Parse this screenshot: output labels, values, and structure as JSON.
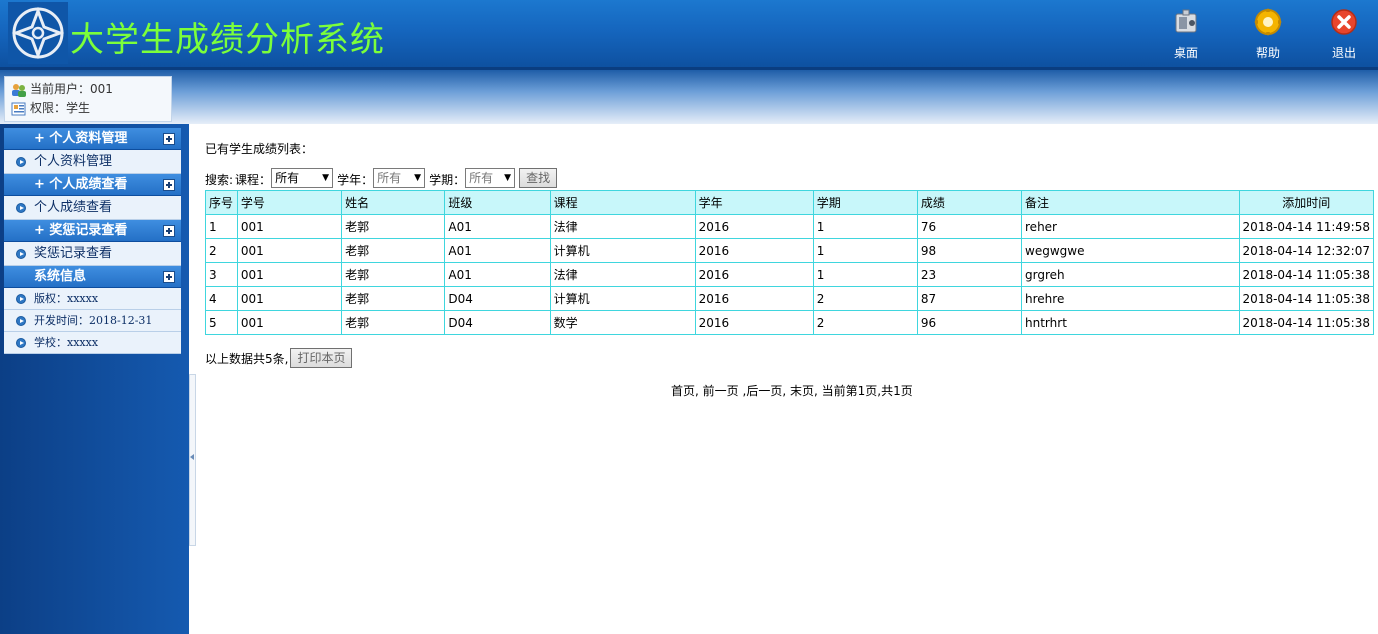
{
  "header": {
    "title": "大学生成绩分析系统",
    "buttons": [
      {
        "label": "桌面",
        "icon": "desktop-icon"
      },
      {
        "label": "帮助",
        "icon": "help-icon"
      },
      {
        "label": "退出",
        "icon": "exit-icon"
      }
    ],
    "title_color": "#7cff3a"
  },
  "user": {
    "current_user": "当前用户：001",
    "role": "权限：学生"
  },
  "sidebar": {
    "sections": [
      {
        "title": "+ 个人资料管理",
        "items": [
          "个人资料管理"
        ]
      },
      {
        "title": "+ 个人成绩查看",
        "items": [
          "个人成绩查看"
        ]
      },
      {
        "title": "+ 奖惩记录查看",
        "items": [
          "奖惩记录查看"
        ]
      },
      {
        "title": "系统信息",
        "items": [
          "版权：xxxxx",
          "开发时间：2018-12-31",
          "学校：xxxxx"
        ]
      }
    ]
  },
  "main": {
    "list_title": "已有学生成绩列表：",
    "search": {
      "label": "搜索:",
      "course_label": "课程：",
      "course_value": "所有",
      "year_label": "学年：",
      "year_value": "所有",
      "term_label": "学期：",
      "term_value": "所有",
      "search_button": "查找"
    },
    "table": {
      "headers": [
        "序号",
        "学号",
        "姓名",
        "班级",
        "课程",
        "学年",
        "学期",
        "成绩",
        "备注",
        "添加时间"
      ],
      "rows": [
        [
          "1",
          "001",
          "老郭",
          "A01",
          "法律",
          "2016",
          "1",
          "76",
          "reher",
          "2018-04-14 11:49:58"
        ],
        [
          "2",
          "001",
          "老郭",
          "A01",
          "计算机",
          "2016",
          "1",
          "98",
          "wegwgwe",
          "2018-04-14 12:32:07"
        ],
        [
          "3",
          "001",
          "老郭",
          "A01",
          "法律",
          "2016",
          "1",
          "23",
          "grgreh",
          "2018-04-14 11:05:38"
        ],
        [
          "4",
          "001",
          "老郭",
          "D04",
          "计算机",
          "2016",
          "2",
          "87",
          "hrehre",
          "2018-04-14 11:05:38"
        ],
        [
          "5",
          "001",
          "老郭",
          "D04",
          "数学",
          "2016",
          "2",
          "96",
          "hntrhrt",
          "2018-04-14 11:05:38"
        ]
      ]
    },
    "summary": "以上数据共5条,",
    "print_button": "打印本页",
    "pager": {
      "first": "首页",
      "prev": "前一页",
      "next": ",后一页",
      "last": "末页",
      "info": "当前第1页,共1页"
    }
  }
}
